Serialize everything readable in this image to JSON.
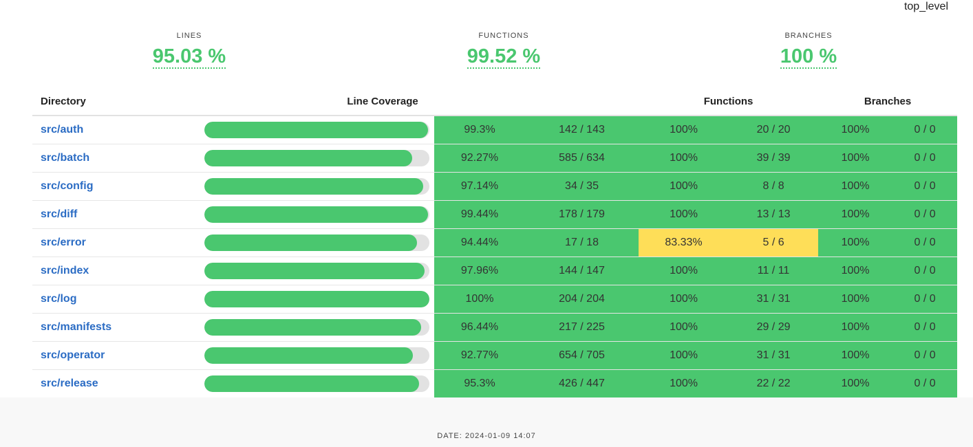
{
  "header": {
    "top_label": "top_level"
  },
  "summary": {
    "lines": {
      "title": "LINES",
      "value": "95.03 %"
    },
    "functions": {
      "title": "FUNCTIONS",
      "value": "99.52 %"
    },
    "branches": {
      "title": "BRANCHES",
      "value": "100 %"
    }
  },
  "table": {
    "headers": {
      "directory": "Directory",
      "line_coverage": "Line Coverage",
      "functions": "Functions",
      "branches": "Branches"
    },
    "rows": [
      {
        "dir": "src/auth",
        "line_pct": "99.3%",
        "line_frac": 0.993,
        "lines": "142 / 143",
        "func_pct": "100%",
        "funcs": "20 / 20",
        "func_status": "green",
        "branch_pct": "100%",
        "branches": "0 / 0"
      },
      {
        "dir": "src/batch",
        "line_pct": "92.27%",
        "line_frac": 0.9227,
        "lines": "585 / 634",
        "func_pct": "100%",
        "funcs": "39 / 39",
        "func_status": "green",
        "branch_pct": "100%",
        "branches": "0 / 0"
      },
      {
        "dir": "src/config",
        "line_pct": "97.14%",
        "line_frac": 0.9714,
        "lines": "34 / 35",
        "func_pct": "100%",
        "funcs": "8 / 8",
        "func_status": "green",
        "branch_pct": "100%",
        "branches": "0 / 0"
      },
      {
        "dir": "src/diff",
        "line_pct": "99.44%",
        "line_frac": 0.9944,
        "lines": "178 / 179",
        "func_pct": "100%",
        "funcs": "13 / 13",
        "func_status": "green",
        "branch_pct": "100%",
        "branches": "0 / 0"
      },
      {
        "dir": "src/error",
        "line_pct": "94.44%",
        "line_frac": 0.9444,
        "lines": "17 / 18",
        "func_pct": "83.33%",
        "funcs": "5 / 6",
        "func_status": "yellow",
        "branch_pct": "100%",
        "branches": "0 / 0"
      },
      {
        "dir": "src/index",
        "line_pct": "97.96%",
        "line_frac": 0.9796,
        "lines": "144 / 147",
        "func_pct": "100%",
        "funcs": "11 / 11",
        "func_status": "green",
        "branch_pct": "100%",
        "branches": "0 / 0"
      },
      {
        "dir": "src/log",
        "line_pct": "100%",
        "line_frac": 1.0,
        "lines": "204 / 204",
        "func_pct": "100%",
        "funcs": "31 / 31",
        "func_status": "green",
        "branch_pct": "100%",
        "branches": "0 / 0"
      },
      {
        "dir": "src/manifests",
        "line_pct": "96.44%",
        "line_frac": 0.9644,
        "lines": "217 / 225",
        "func_pct": "100%",
        "funcs": "29 / 29",
        "func_status": "green",
        "branch_pct": "100%",
        "branches": "0 / 0"
      },
      {
        "dir": "src/operator",
        "line_pct": "92.77%",
        "line_frac": 0.9277,
        "lines": "654 / 705",
        "func_pct": "100%",
        "funcs": "31 / 31",
        "func_status": "green",
        "branch_pct": "100%",
        "branches": "0 / 0"
      },
      {
        "dir": "src/release",
        "line_pct": "95.3%",
        "line_frac": 0.953,
        "lines": "426 / 447",
        "func_pct": "100%",
        "funcs": "22 / 22",
        "func_status": "green",
        "branch_pct": "100%",
        "branches": "0 / 0"
      }
    ]
  },
  "colors": {
    "accent_green": "#4ac76f",
    "warn_yellow": "#fede58",
    "link_blue": "#2b6cc4",
    "bar_track": "#e2e2e2"
  },
  "footer": {
    "date": "DATE: 2024-01-09 14:07"
  }
}
